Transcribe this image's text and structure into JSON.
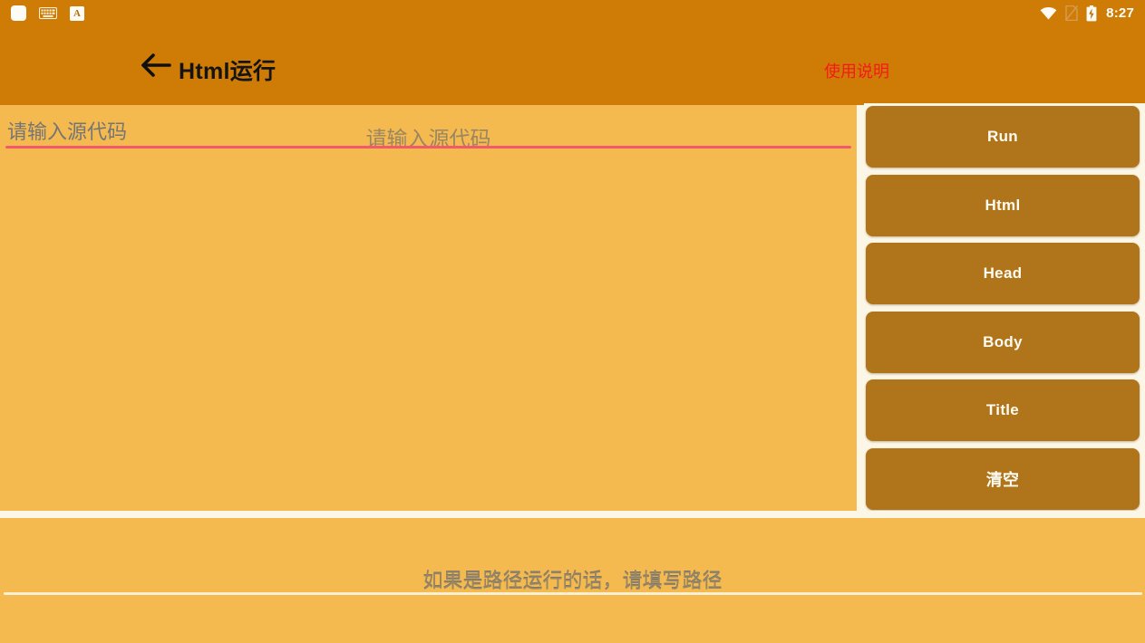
{
  "status_bar": {
    "left_icons": [
      {
        "name": "app-placeholder-icon",
        "label": ""
      },
      {
        "name": "keyboard-icon",
        "label": ""
      },
      {
        "name": "input-method-a-icon",
        "label": "A"
      }
    ],
    "right_icons": [
      {
        "name": "wifi-icon",
        "label": ""
      },
      {
        "name": "sim-card-off-icon",
        "label": ""
      },
      {
        "name": "battery-charging-icon",
        "label": ""
      }
    ],
    "time": "8:27"
  },
  "header": {
    "back_label": "",
    "title": "Html运行",
    "help_label": "使用说明",
    "help_color": "#F51919",
    "background": "#CE7C06",
    "title_color": "#141414"
  },
  "editor": {
    "placeholder": "请输入源代码",
    "value": "",
    "underline_color": "#F25A6B",
    "background": "#F4BA4F"
  },
  "buttons": [
    {
      "label": "Run",
      "name": "run-button",
      "cjk": false
    },
    {
      "label": "Html",
      "name": "html-button",
      "cjk": false
    },
    {
      "label": "Head",
      "name": "head-button",
      "cjk": false
    },
    {
      "label": "Body",
      "name": "body-button",
      "cjk": false
    },
    {
      "label": "Title",
      "name": "title-button",
      "cjk": false
    },
    {
      "label": "清空",
      "name": "clear-button",
      "cjk": true
    }
  ],
  "button_style": {
    "background": "#B0741A",
    "text_color": "#FDFBF2"
  },
  "path_field": {
    "placeholder": "如果是路径运行的话，请填写路径",
    "value": "",
    "underline_color": "#FCF0D3"
  },
  "palette": {
    "page_background": "#F2B84B",
    "panel_background": "#F4BA4F",
    "divider": "#FCF6E6",
    "header": "#CE7C06",
    "accent_red": "#F51919"
  }
}
